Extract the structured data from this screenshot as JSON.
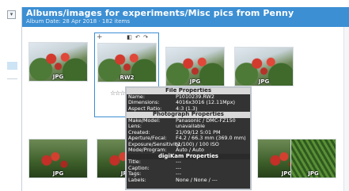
{
  "header": {
    "title": "Albums/images for experiments/Misc pics from Penny",
    "subtitle": "Album Date: 28 Apr 2018 · 182 items"
  },
  "thumbnails": [
    {
      "badge": "JPG"
    },
    {
      "badge": "RW2"
    },
    {
      "badge": "JPG"
    },
    {
      "badge": "JPG"
    },
    {
      "badge": "JPG"
    },
    {
      "badge": "JPG"
    },
    {
      "badge": "JPG"
    },
    {
      "badge": "JPG"
    }
  ],
  "selected_toolbar": {
    "plus": "+",
    "tools": "◧ ↶ ↷"
  },
  "rating": "☆☆☆",
  "popup": {
    "file_title": "File Properties",
    "file_rows": [
      {
        "k": "Name:",
        "v": "P1010239.RW2"
      },
      {
        "k": "Dimensions:",
        "v": "4016x3016 (12.11Mpx)"
      },
      {
        "k": "Aspect Ratio:",
        "v": "4:3 (1.3)"
      }
    ],
    "photo_title": "Photograph Properties",
    "photo_rows": [
      {
        "k": "Make/Model:",
        "v": "Panasonic / DMC-FZ150"
      },
      {
        "k": "Lens:",
        "v": "unavailable"
      },
      {
        "k": "Created:",
        "v": "21/09/12 5:01 PM"
      },
      {
        "k": "Aperture/Focal:",
        "v": "F4.2 / 66.3 mm (369.0 mm)"
      },
      {
        "k": "Exposure/Sensitivity:",
        "v": "(1/100) / 100 ISO"
      },
      {
        "k": "Mode/Program:",
        "v": "Auto / Auto"
      }
    ],
    "digikam_title": "digiKam Properties",
    "digikam_rows": [
      {
        "k": "Title:",
        "v": "---"
      },
      {
        "k": "Caption:",
        "v": "---"
      },
      {
        "k": "Tags:",
        "v": "---"
      },
      {
        "k": "Labels:",
        "v": "None / None / ---"
      }
    ]
  },
  "colors": {
    "header_bg": "#3c8fd3",
    "popup_bg": "#333333",
    "accent": "#3c8fd3"
  }
}
